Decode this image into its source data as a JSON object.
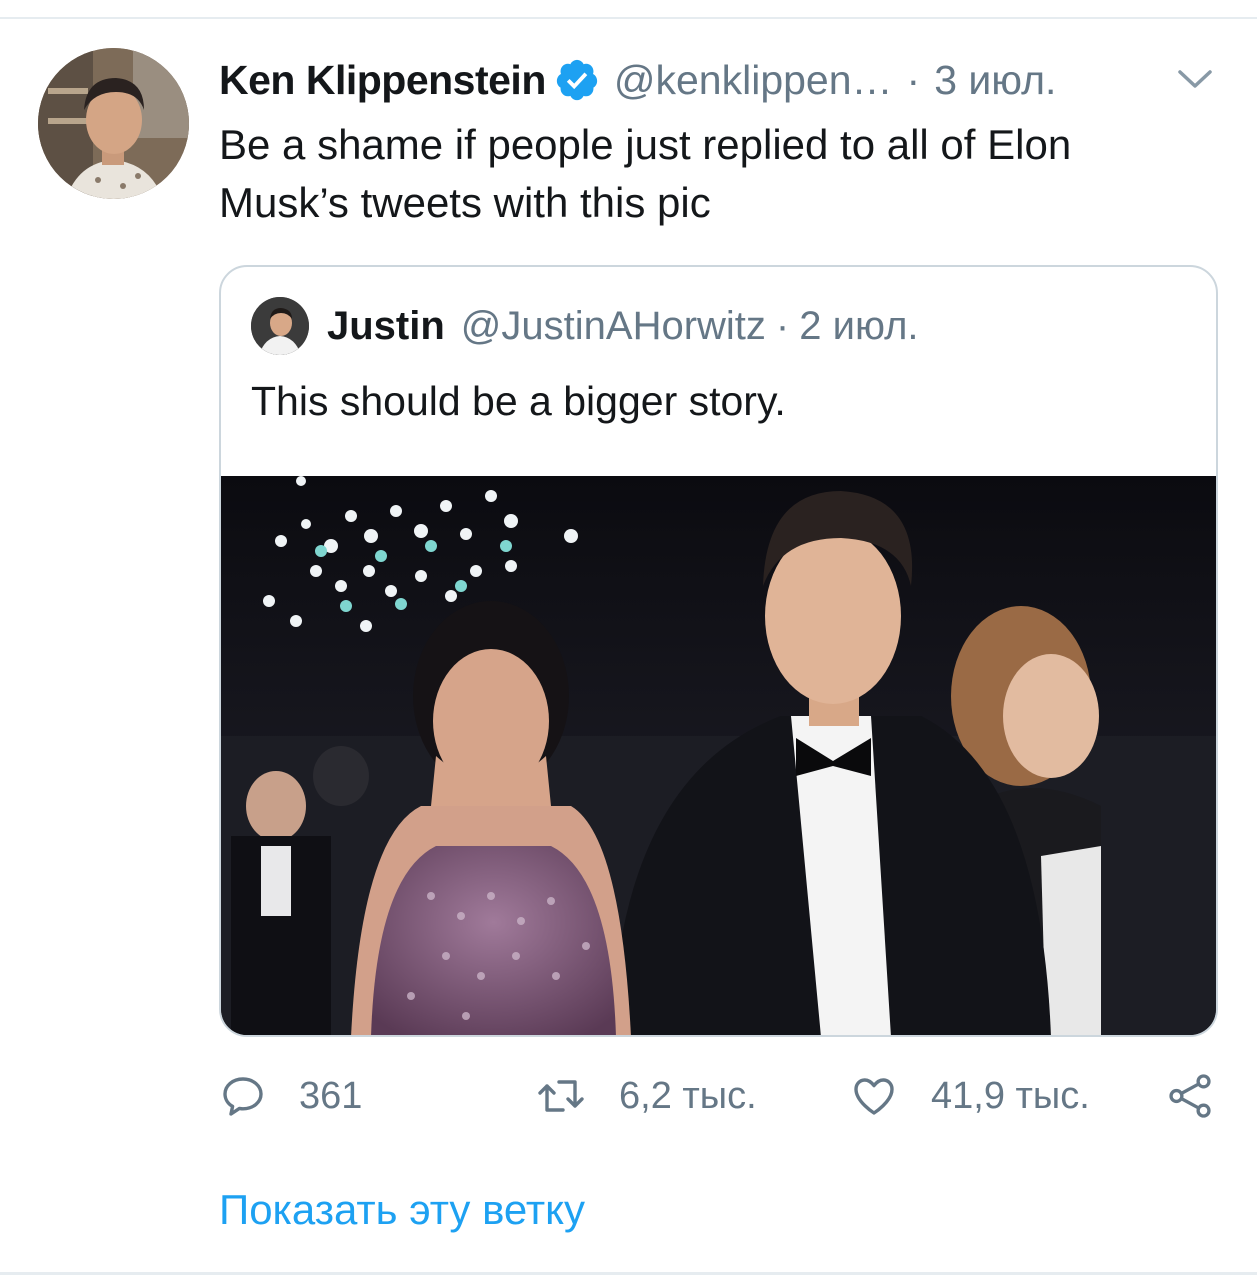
{
  "tweet": {
    "author_name": "Ken Klippenstein",
    "handle": "@kenklippen…",
    "separator": "·",
    "date": "3 июл.",
    "text": "Be a shame if people just replied to all of Elon\nMusk’s tweets with this pic",
    "icons": {
      "verified": "verified-badge-icon",
      "menu": "chevron-down-icon"
    }
  },
  "quoted_tweet": {
    "author_name": "Justin",
    "handle": "@JustinAHorwitz",
    "separator": "·",
    "date": "2 июл.",
    "text": "This should be a bigger story."
  },
  "actions": {
    "reply_count": "361",
    "retweet_count": "6,2 тыс.",
    "like_count": "41,9 тыс.",
    "icons": [
      "reply-icon",
      "retweet-icon",
      "like-icon",
      "share-icon"
    ]
  },
  "show_thread_label": "Показать эту ветку",
  "colors": {
    "accent": "#1da1f2",
    "text_primary": "#14171a",
    "text_secondary": "#657786",
    "border": "#ccd6dd"
  }
}
